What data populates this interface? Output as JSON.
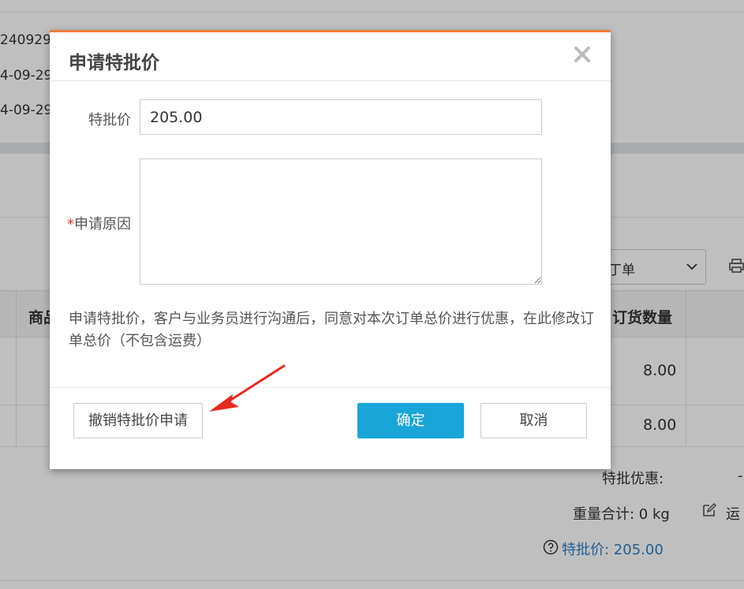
{
  "background": {
    "order_no_partial": "240929",
    "date_1_partial": "4-09-29",
    "date_2_partial": "4-09-29",
    "select_value_partial": "丁单",
    "col_goods_partial": "商品",
    "col_order_qty": "订货数量",
    "row_1_qty": "8.00",
    "row_2_qty": "8.00",
    "discount_label": "特批优惠:",
    "discount_value_partial": "-",
    "weight_total": "重量合计: 0 kg",
    "freight_partial": "运",
    "special_price_link": "特批价: 205.00"
  },
  "modal": {
    "title": "申请特批价",
    "price_label": "特批价",
    "price_value": "205.00",
    "reason_required_mark": "*",
    "reason_label": "申请原因",
    "reason_value": "",
    "note": "申请特批价，客户与业务员进行沟通后，同意对本次订单总价进行优惠，在此修改订单总价（不包含运费）",
    "revoke_button": "撤销特批价申请",
    "ok_button": "确定",
    "cancel_button": "取消"
  },
  "colors": {
    "accent_top_border": "#f07c3a",
    "primary_button": "#1aa5d8",
    "required_mark": "#e23b2e",
    "link": "#2f7ec0",
    "annotation_arrow": "#e8281e"
  },
  "icons": [
    "close-icon",
    "chevron-down-icon",
    "print-icon",
    "edit-icon",
    "help-circle-icon",
    "annotation-arrow"
  ]
}
